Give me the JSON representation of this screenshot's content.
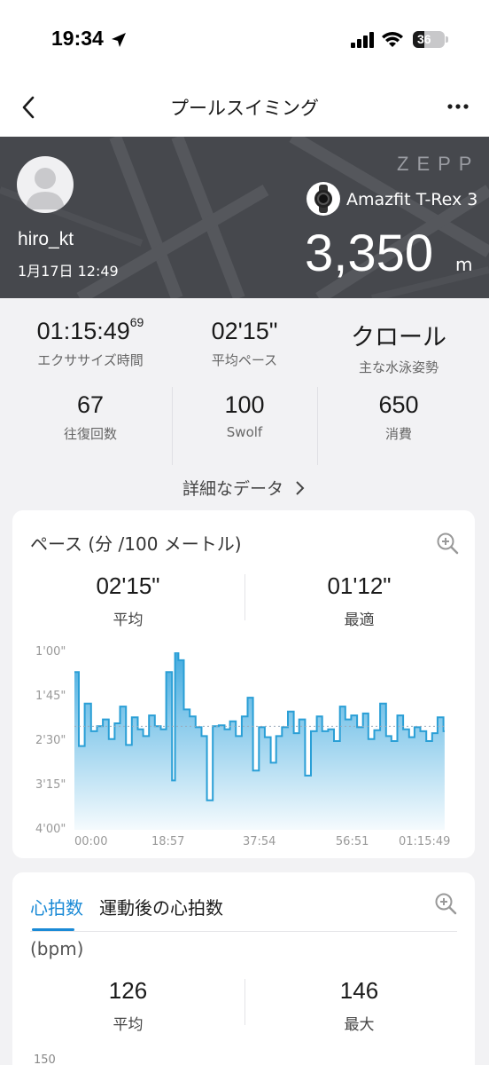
{
  "status_bar": {
    "time": "19:34",
    "battery": "36"
  },
  "nav": {
    "title": "プールスイミング"
  },
  "header": {
    "username": "hiro_kt",
    "datetime": "1月17日 12:49",
    "brand": "ZEPP",
    "device": "Amazfit T-Rex 3",
    "distance": "3,350",
    "distance_unit": "m"
  },
  "stats": [
    {
      "value": "01:15:49",
      "value_suffix": "69",
      "label": "エクササイズ時間"
    },
    {
      "value": "02'15\"",
      "label": "平均ペース"
    },
    {
      "value": "クロール",
      "label": "主な水泳姿勢"
    },
    {
      "value": "67",
      "label": "往復回数"
    },
    {
      "value": "100",
      "label": "Swolf"
    },
    {
      "value": "650",
      "label": "消費"
    }
  ],
  "detail_link": "詳細なデータ",
  "pace_card": {
    "title": "ペース (分 /100 メートル)",
    "avg_value": "02'15\"",
    "avg_label": "平均",
    "best_value": "01'12\"",
    "best_label": "最適"
  },
  "chart_data": {
    "type": "area",
    "title": "ペース (分 /100 メートル)",
    "y_tick_labels": [
      "1'00\"",
      "1'45\"",
      "2'30\"",
      "3'15\"",
      "4'00\""
    ],
    "y_tick_values_sec": [
      60,
      105,
      150,
      195,
      240
    ],
    "ylim_sec": [
      60,
      240
    ],
    "y_inverted": true,
    "x_tick_labels": [
      "00:00",
      "18:57",
      "37:54",
      "56:51",
      "01:15:49"
    ],
    "x_tick_values_min": [
      0,
      18.95,
      37.9,
      56.85,
      75.82
    ],
    "xlim_min": [
      0,
      75.82
    ],
    "average_line_sec": 135,
    "color": "#2a9fd6",
    "series": [
      {
        "x": [
          0,
          0.9,
          2.1,
          3.4,
          4.6,
          5.8,
          7.0,
          8.2,
          9.3,
          10.5,
          11.7,
          12.9,
          14.0,
          15.2,
          16.4,
          17.6,
          18.7,
          19.9,
          20.5,
          21.2,
          22.3,
          23.5,
          24.7,
          25.9,
          27.0,
          28.2,
          29.4,
          30.6,
          31.7,
          32.9,
          34.1,
          35.3,
          36.4,
          37.6,
          38.8,
          40.0,
          41.1,
          42.3,
          43.5,
          44.7,
          45.8,
          47.0,
          48.2,
          49.4,
          50.5,
          51.7,
          52.9,
          54.1,
          55.2,
          56.4,
          57.6,
          58.8,
          59.9,
          61.1,
          62.3,
          63.5,
          64.6,
          65.8,
          67.0,
          68.2,
          69.3,
          70.5,
          71.7,
          72.9,
          74.0,
          75.2
        ],
        "y": [
          80,
          155,
          112,
          140,
          135,
          128,
          148,
          132,
          115,
          154,
          126,
          138,
          145,
          124,
          135,
          138,
          80,
          190,
          60,
          68,
          118,
          125,
          136,
          145,
          210,
          135,
          134,
          138,
          130,
          145,
          125,
          106,
          180,
          136,
          146,
          172,
          145,
          136,
          120,
          142,
          128,
          185,
          140,
          125,
          140,
          138,
          150,
          115,
          128,
          124,
          136,
          122,
          148,
          139,
          112,
          145,
          150,
          124,
          138,
          146,
          136,
          140,
          150,
          142,
          126,
          140
        ]
      }
    ]
  },
  "hr_card": {
    "tab_active": "心拍数",
    "tab_inactive": "運動後の心拍数",
    "unit": "(bpm)",
    "avg_value": "126",
    "avg_label": "平均",
    "max_value": "146",
    "max_label": "最大",
    "y_first_tick": "150"
  },
  "colors": {
    "accent": "#1a8ad6",
    "hero_bg": "#46484d",
    "chart_fill": "#2a9fd6"
  }
}
